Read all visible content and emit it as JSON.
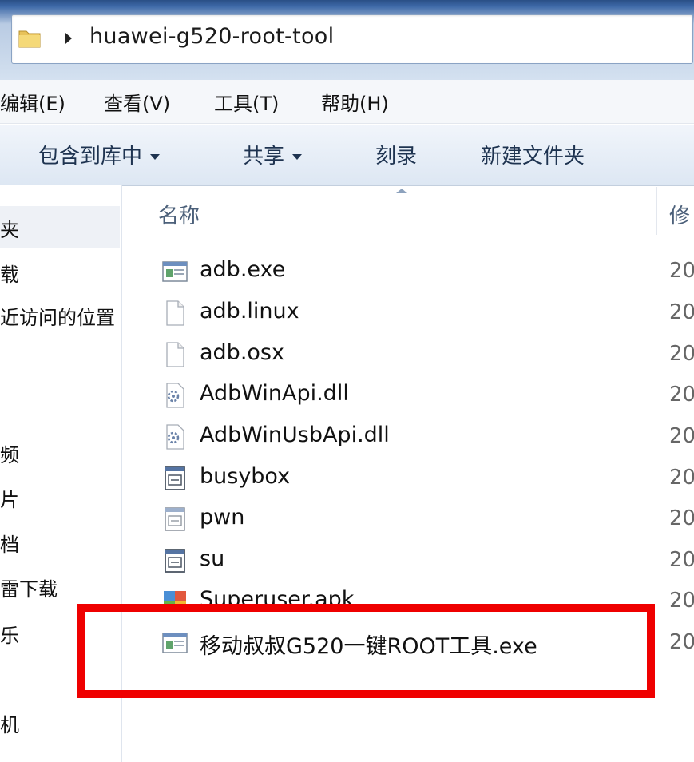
{
  "address": {
    "path": "huawei-g520-root-tool"
  },
  "menu": [
    "编辑(E)",
    "查看(V)",
    "工具(T)",
    "帮助(H)"
  ],
  "toolbar": {
    "include_library": "包含到库中",
    "share": "共享",
    "burn": "刻录",
    "new_folder": "新建文件夹"
  },
  "nav": [
    "夹",
    "载",
    "近访问的位置",
    "频",
    "片",
    "档",
    "雷下载",
    "乐",
    "机"
  ],
  "columns": {
    "name": "名称",
    "modified": "修"
  },
  "files": [
    {
      "name": "adb.exe",
      "icon": "exe-icon",
      "date": "20"
    },
    {
      "name": "adb.linux",
      "icon": "blank-file-icon",
      "date": "20"
    },
    {
      "name": "adb.osx",
      "icon": "blank-file-icon",
      "date": "20"
    },
    {
      "name": "AdbWinApi.dll",
      "icon": "dll-icon",
      "date": "20"
    },
    {
      "name": "AdbWinUsbApi.dll",
      "icon": "dll-icon",
      "date": "20"
    },
    {
      "name": "busybox",
      "icon": "system-file-icon",
      "date": "20"
    },
    {
      "name": "pwn",
      "icon": "system-file-icon",
      "date": "20"
    },
    {
      "name": "su",
      "icon": "system-file-icon",
      "date": "20"
    },
    {
      "name": "Superuser.apk",
      "icon": "apk-icon",
      "date": "20"
    },
    {
      "name": "移动叔叔G520一键ROOT工具.exe",
      "icon": "exe-icon",
      "date": "20"
    }
  ],
  "highlight_color": "#ef0000"
}
